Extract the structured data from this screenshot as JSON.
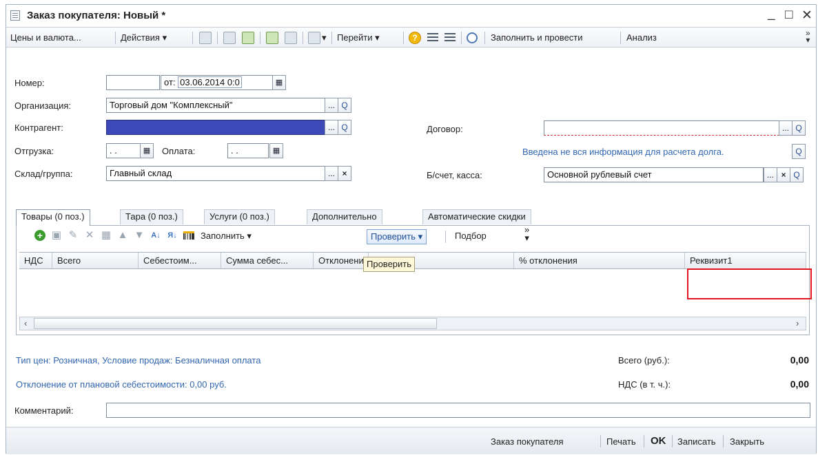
{
  "window": {
    "title": "Заказ покупателя: Новый *",
    "min": "_",
    "max": "□",
    "close": "✕"
  },
  "toolbar": {
    "prices_currency": "Цены и валюта...",
    "actions": "Действия ▾",
    "navigate": "Перейти ▾",
    "help": "?",
    "fill_and_post": "Заполнить и провести",
    "analysis": "Анализ",
    "more": "»"
  },
  "form": {
    "number_label": "Номер:",
    "number_value": "",
    "date_label": "от:",
    "date_value": "03.06.2014  0:0",
    "org_label": "Организация:",
    "org_value": "Торговый дом \"Комплексный\"",
    "counterparty_label": "Контрагент:",
    "counterparty_value": "",
    "contract_label": "Договор:",
    "contract_value": "",
    "shipment_label": "Отгрузка:",
    "shipment_value": " .  . ",
    "payment_label": "Оплата:",
    "payment_value": " .  . ",
    "debt_info_link": "Введена не вся информация для расчета долга.",
    "warehouse_label": "Склад/группа:",
    "warehouse_value": "Главный склад",
    "account_label": "Б/счет, касса:",
    "account_value": "Основной рублевый счет",
    "ellipsis": "...",
    "search": "Q",
    "clear": "×",
    "calendar": "▦"
  },
  "tabs": [
    {
      "label": "Товары (0 поз.)"
    },
    {
      "label": "Тара (0 поз.)"
    },
    {
      "label": "Услуги (0 поз.)"
    },
    {
      "label": "Дополнительно"
    },
    {
      "label": "Автоматические скидки"
    }
  ],
  "gridbar": {
    "fill": "Заполнить ▾",
    "check": "Проверить ▾",
    "selection": "Подбор",
    "more": "»"
  },
  "grid": {
    "columns": [
      "НДС",
      "Всего",
      "Себестоим...",
      "Сумма себес...",
      "Отклонени",
      "",
      "% отклонения",
      "Реквизит1"
    ],
    "tooltip": "Проверить"
  },
  "summary": {
    "price_info_link": "Тип цен: Розничная, Условие продаж: Безналичная оплата",
    "deviation_link": "Отклонение от плановой себестоимости: 0,00 руб.",
    "total_label": "Всего (руб.):",
    "total_value": "0,00",
    "vat_label": "НДС (в т. ч.):",
    "vat_value": "0,00",
    "comment_label": "Комментарий:",
    "comment_value": ""
  },
  "statusbar": {
    "order": "Заказ покупателя",
    "print": "Печать",
    "ok": "OK",
    "save": "Записать",
    "close": "Закрыть"
  },
  "colors": {
    "selected_field": "#3c49b6",
    "link": "#3166b0",
    "highlight_frame": "#e0141a"
  }
}
